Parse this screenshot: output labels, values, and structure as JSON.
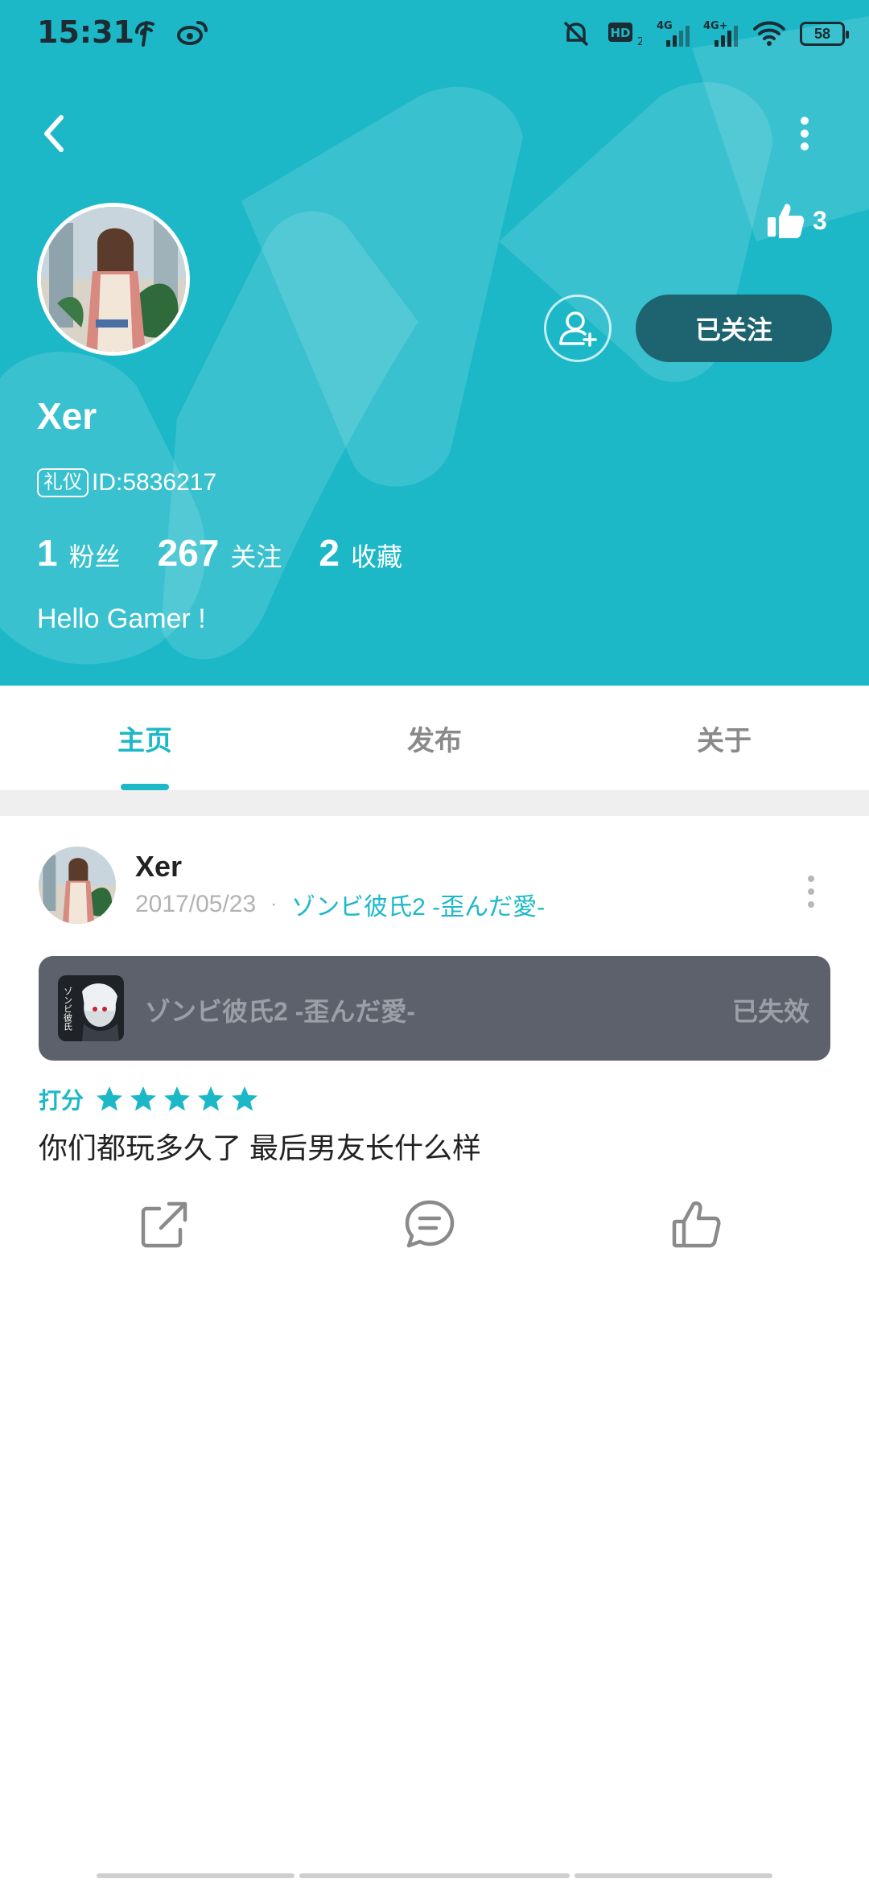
{
  "status_bar": {
    "time": "15:31",
    "battery": "58",
    "icons": [
      "telecom-icon",
      "weibo-icon",
      "mute-icon",
      "hd-icon",
      "signal-4g-icon",
      "signal-4g-plus-icon",
      "wifi-icon",
      "battery-icon"
    ]
  },
  "profile": {
    "like_count": "3",
    "follow_button": "已关注",
    "username": "Xer",
    "badge": "礼仪",
    "id_text": "ID:5836217",
    "stats": [
      {
        "num": "1",
        "label": "粉丝"
      },
      {
        "num": "267",
        "label": "关注"
      },
      {
        "num": "2",
        "label": "收藏"
      }
    ],
    "bio": "Hello Gamer !"
  },
  "tabs": [
    {
      "label": "主页",
      "active": true
    },
    {
      "label": "发布",
      "active": false
    },
    {
      "label": "关于",
      "active": false
    }
  ],
  "post": {
    "author": "Xer",
    "date": "2017/05/23",
    "separator": "·",
    "game_link": "ゾンビ彼氏2 -歪んだ愛-",
    "game_card": {
      "title": "ゾンビ彼氏2 -歪んだ愛-",
      "status": "已失效",
      "icon_text": "ゾンビ彼氏"
    },
    "rating_label": "打分",
    "rating_stars": 5,
    "text": "你们都玩多久了 最后男友长什么样"
  },
  "colors": {
    "accent": "#1cb8c8",
    "follow_button_bg": "#1e6370",
    "game_card_bg": "#5d616b"
  }
}
